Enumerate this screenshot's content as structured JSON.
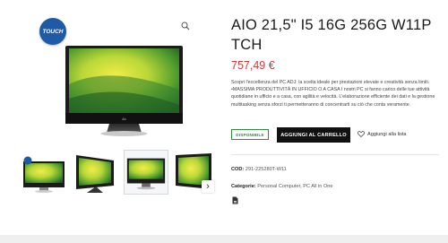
{
  "product": {
    "title": "AIO 21,5\" I5 16G 256G W11P TCH",
    "price": "757,49 €",
    "badge_text": "TOUCH",
    "screen_brand": "Aio",
    "description": [
      "Scopri l'eccellenza del PC ADJ: la scelta ideale per prestazioni elevate e creatività senza limiti.",
      "•MASSIMA PRODUTTIVITÀ IN UFFICIO O A CASA I nostri PC si fanno carico delle tue attività quotidiane in ufficio e a casa, con agilità e velocità. L'elaborazione efficiente dei dati e la gestione multitasking senza sforzi ti permetteranno di concentrarti su ciò che conta veramente."
    ],
    "availability": "DISPONIBILE",
    "add_to_cart_label": "AGGIUNGI AL CARRELLO",
    "wishlist_label": "Aggiungi alla lista",
    "sku_label": "COD:",
    "sku_value": "291-225280T-W11",
    "categories_label": "Categorie:",
    "categories": [
      "Personal Computer",
      "PC All in One"
    ],
    "category_separator": ","
  },
  "gallery": {
    "thumbnail_count": 4,
    "active_thumbnail": 3,
    "next_arrow": "›"
  },
  "icons": [
    "search-icon",
    "heart-icon",
    "document-icon",
    "chevron-right-icon"
  ],
  "colors": {
    "price": "#d23a3a",
    "availability": "#2e8b3a",
    "cart_button": "#111111",
    "touch_badge": "#1f5aa6"
  }
}
